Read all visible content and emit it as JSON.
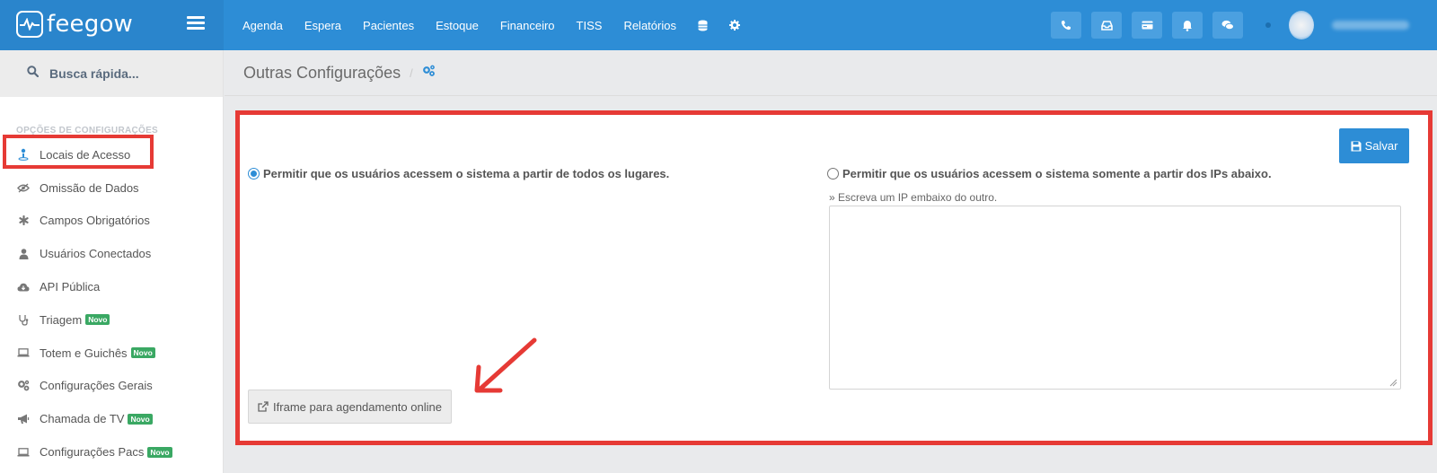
{
  "brand": {
    "name": "feegow"
  },
  "nav": {
    "items": [
      "Agenda",
      "Espera",
      "Pacientes",
      "Estoque",
      "Financeiro",
      "TISS",
      "Relatórios"
    ]
  },
  "search": {
    "placeholder": "Busca rápida..."
  },
  "sidebar": {
    "section_title": "Opções de configurações",
    "items": [
      {
        "label": "Locais de Acesso",
        "icon": "user-pin-icon"
      },
      {
        "label": "Omissão de Dados",
        "icon": "eye-slash-icon"
      },
      {
        "label": "Campos Obrigatórios",
        "icon": "asterisk-icon"
      },
      {
        "label": "Usuários Conectados",
        "icon": "user-icon"
      },
      {
        "label": "API Pública",
        "icon": "cloud-icon"
      },
      {
        "label": "Triagem",
        "icon": "stethoscope-icon",
        "badge": "Novo"
      },
      {
        "label": "Totem e Guichês",
        "icon": "laptop-icon",
        "badge": "Novo"
      },
      {
        "label": "Configurações Gerais",
        "icon": "cogs-icon"
      },
      {
        "label": "Chamada de TV",
        "icon": "bullhorn-icon",
        "badge": "Novo"
      },
      {
        "label": "Configurações Pacs",
        "icon": "laptop-icon",
        "badge": "Novo"
      }
    ]
  },
  "page": {
    "title": "Outras Configurações"
  },
  "form": {
    "save_label": "Salvar",
    "option_all": "Permitir que os usuários acessem o sistema a partir de todos os lugares.",
    "option_ips": "Permitir que os usuários acessem o sistema somente a partir dos IPs abaixo.",
    "ip_hint": "» Escreva um IP embaixo do outro.",
    "ip_value": "",
    "iframe_label": "Iframe para agendamento online",
    "selected_option": "all"
  },
  "colors": {
    "topbar": "#2d8dd6",
    "highlight": "#e63a35",
    "badge": "#3aa863"
  }
}
